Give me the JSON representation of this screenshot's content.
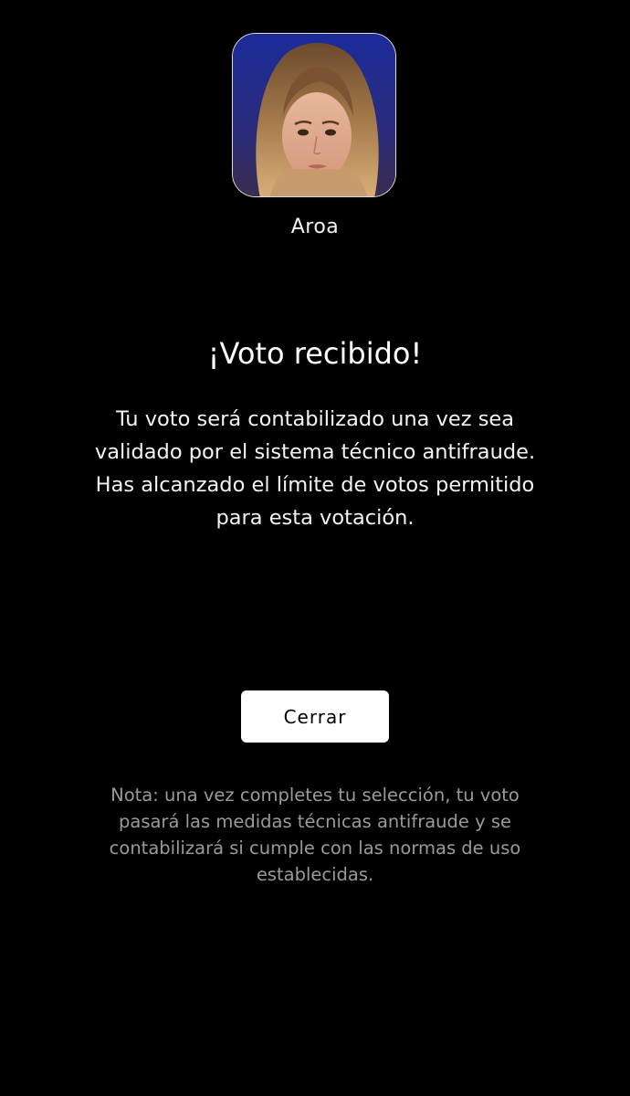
{
  "contestant": {
    "name": "Aroa",
    "photo_icon": "contestant-photo"
  },
  "confirmation": {
    "title": "¡Voto recibido!",
    "message_lines": [
      "Tu voto será contabilizado una vez sea",
      "validado por el sistema técnico antifraude.",
      "Has alcanzado el límite de votos permitido",
      "para esta votación."
    ]
  },
  "actions": {
    "close_label": "Cerrar"
  },
  "note": {
    "lines": [
      "Nota: una vez completes tu selección, tu voto",
      "pasará las medidas técnicas antifraude y se",
      "contabilizará si cumple con las normas de uso",
      "establecidas."
    ]
  },
  "colors": {
    "background": "#000000",
    "text": "#ffffff",
    "note_text": "#9a9a9a",
    "button_bg": "#ffffff",
    "button_text": "#000000"
  }
}
